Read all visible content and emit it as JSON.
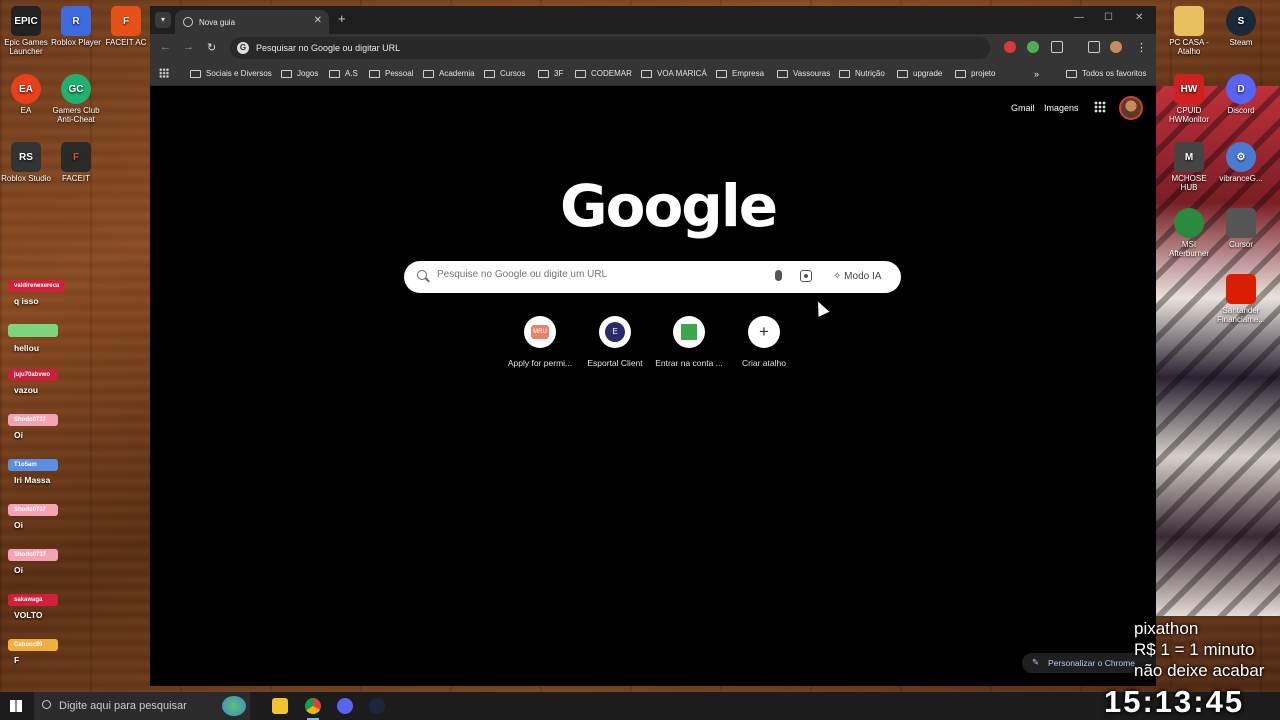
{
  "desktop": {
    "icons_left": [
      {
        "label": "Epic Games Launcher",
        "glyph": "EPIC",
        "color": "#222222"
      },
      {
        "label": "Roblox Player",
        "glyph": "R",
        "color": "#3d6be0"
      },
      {
        "label": "FACEIT AC",
        "glyph": "F",
        "color": "#e8501a"
      },
      {
        "label": "EA",
        "glyph": "EA",
        "color": "#e8401a"
      },
      {
        "label": "Gamers Club Anti-Cheat",
        "glyph": "GC",
        "color": "#20b070"
      },
      {
        "label": "Roblox Studio",
        "glyph": "RS",
        "color": "#333333"
      },
      {
        "label": "FACEIT",
        "glyph": "F",
        "color": "#2a2a2a"
      }
    ],
    "icons_right": [
      {
        "label": "PC CASA - Atalho",
        "glyph": "",
        "color": "#e8c060"
      },
      {
        "label": "Steam",
        "glyph": "S",
        "color": "#1b2838"
      },
      {
        "label": "CPUID HWMonitor",
        "glyph": "HW",
        "color": "#d02020"
      },
      {
        "label": "Discord",
        "glyph": "D",
        "color": "#5865f2"
      },
      {
        "label": "MCHOSE HUB",
        "glyph": "M",
        "color": "#444444"
      },
      {
        "label": "vibranceG...",
        "glyph": "⚙",
        "color": "#4a7bd0"
      },
      {
        "label": "MSI Afterburner",
        "glyph": "",
        "color": "#2a8a40"
      },
      {
        "label": "Cursor",
        "glyph": "",
        "color": "#555555"
      },
      {
        "label": "Santander Financiame...",
        "glyph": "",
        "color": "#d81e05"
      }
    ]
  },
  "chat": [
    {
      "user": "valdirenexereca",
      "user_color": "#d0203a",
      "message": "q isso"
    },
    {
      "user": "",
      "user_color": "#7ed37e",
      "message": "hellou"
    },
    {
      "user": "juju70abvwo",
      "user_color": "#c8203a",
      "message": "vazou"
    },
    {
      "user": "Shodo0737",
      "user_color": "#f4a3b4",
      "message": "Oi"
    },
    {
      "user": "T1o5am",
      "user_color": "#5b8de0",
      "message": "Iri Massa"
    },
    {
      "user": "Shodo0737",
      "user_color": "#f4a3b4",
      "message": "Oi"
    },
    {
      "user": "Shodo0737",
      "user_color": "#f4a3b4",
      "message": "Oi"
    },
    {
      "user": "sakawaga",
      "user_color": "#d0203a",
      "message": "VOLTO"
    },
    {
      "user": "Cabocc99",
      "user_color": "#f0b040",
      "message": "F"
    }
  ],
  "browser": {
    "tab": {
      "title": "Nova guia"
    },
    "omnibox": {
      "text": "Pesquisar no Google ou digitar URL"
    },
    "bookmarks": [
      "Sociais e Diversos",
      "Jogos",
      "A.S",
      "Pessoal",
      "Academia",
      "Cursos",
      "3F",
      "CODEMAR",
      "VOA MARICÁ",
      "Empresa",
      "Vassouras",
      "Nutrição",
      "upgrade",
      "projeto"
    ],
    "bookmarks_all": "Todos os favoritos",
    "top_links": {
      "gmail": "Gmail",
      "images": "Imagens"
    },
    "logo": "Google",
    "search": {
      "placeholder": "Pesquise no Google ou digite um URL",
      "ai_mode": "Modo IA"
    },
    "shortcuts": [
      {
        "label": "Apply for permi...",
        "glyph": "MRU",
        "color": "#e8826a"
      },
      {
        "label": "Esportal Client",
        "glyph": "E",
        "color": "#2b2b6b"
      },
      {
        "label": "Entrar na conta ...",
        "glyph": "",
        "color": "#3aa84a"
      },
      {
        "label": "Criar atalho",
        "glyph": "+",
        "color": "#ffffff"
      }
    ],
    "customize": "Personalizar o Chrome"
  },
  "taskbar": {
    "search_placeholder": "Digite aqui para pesquisar"
  },
  "overlay": {
    "donation_lines": [
      "pixathon",
      "R$ 1 = 1 minuto",
      "não deixe acabar"
    ],
    "timer": "15:13:45"
  }
}
